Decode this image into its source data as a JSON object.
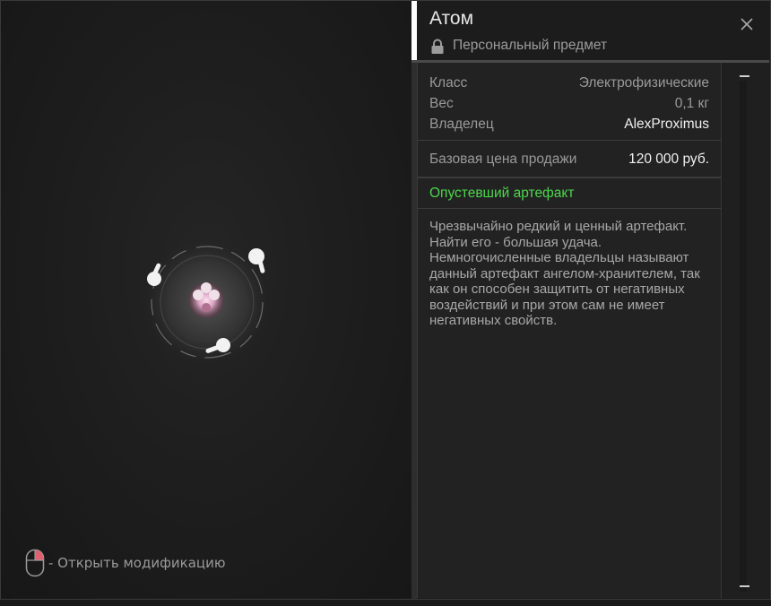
{
  "item": {
    "name": "Атом",
    "binding": "Персональный предмет"
  },
  "stats": {
    "class_label": "Класс",
    "class_value": "Электрофизические",
    "weight_label": "Вес",
    "weight_value": "0,1 кг",
    "owner_label": "Владелец",
    "owner_value": "AlexProximus"
  },
  "price": {
    "label": "Базовая цена продажи",
    "value": "120 000 руб."
  },
  "state": "Опустевший артефакт",
  "description": "Чрезвычайно редкий и ценный артефакт. Найти его - большая удача. Немногочисленные владельцы называют данный артефакт ангелом-хранителем, так как он способен защитить от негативных воздействий и при этом сам не имеет негативных свойств.",
  "hint": {
    "text": "- Открыть модификацию"
  },
  "icons": {
    "close": "close-icon",
    "lock": "lock-icon",
    "mouse": "mouse-right-click-icon"
  },
  "colors": {
    "accent_title_bar": "#ffffff",
    "state_green": "#4cd64c",
    "mouse_highlight": "#e06070"
  }
}
